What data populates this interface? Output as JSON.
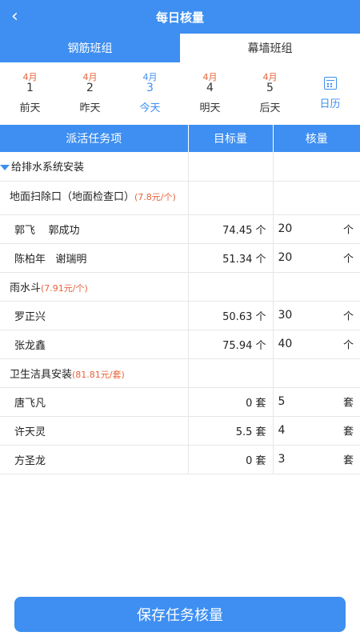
{
  "header": {
    "title": "每日核量"
  },
  "tabs": [
    {
      "label": "钢筋班组"
    },
    {
      "label": "幕墙班组"
    }
  ],
  "dates": [
    {
      "month": "4月",
      "day": "1",
      "label": "前天"
    },
    {
      "month": "4月",
      "day": "2",
      "label": "昨天"
    },
    {
      "month": "4月",
      "day": "3",
      "label": "今天"
    },
    {
      "month": "4月",
      "day": "4",
      "label": "明天"
    },
    {
      "month": "4月",
      "day": "5",
      "label": "后天"
    }
  ],
  "calendar": {
    "label": "日历"
  },
  "table": {
    "headers": [
      "派活任务项",
      "目标量",
      "核量"
    ],
    "section": "给排水系统安装",
    "groups": [
      {
        "name": "地面扫除口（地面检查口）",
        "price": "(7.8元/个)",
        "rows": [
          {
            "workers": "郭飞    郭成功",
            "target": "74.45 个",
            "actual": "20",
            "unit": "个"
          },
          {
            "workers": "陈柏年   谢瑞明",
            "target": "51.34 个",
            "actual": "20",
            "unit": "个"
          }
        ]
      },
      {
        "name": "雨水斗",
        "price": "(7.91元/个)",
        "rows": [
          {
            "workers": "罗正兴",
            "target": "50.63 个",
            "actual": "30",
            "unit": "个"
          },
          {
            "workers": "张龙鑫",
            "target": "75.94 个",
            "actual": "40",
            "unit": "个"
          }
        ]
      },
      {
        "name": "卫生洁具安装",
        "price": "(81.81元/套)",
        "rows": [
          {
            "workers": "唐飞凡",
            "target": "0 套",
            "actual": "5",
            "unit": "套"
          },
          {
            "workers": "许天灵",
            "target": "5.5 套",
            "actual": "4",
            "unit": "套"
          },
          {
            "workers": "方圣龙",
            "target": "0 套",
            "actual": "3",
            "unit": "套"
          }
        ]
      }
    ]
  },
  "save_button": {
    "label": "保存任务核量"
  }
}
